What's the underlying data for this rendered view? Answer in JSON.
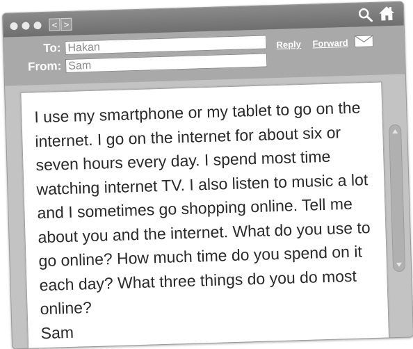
{
  "email": {
    "to_label": "To:",
    "to_value": "Hakan",
    "from_label": "From:",
    "from_value": "Sam",
    "reply_label": "Reply",
    "forward_label": "Forward",
    "body_text": "I use my smartphone or my tablet to go on the internet. I go on the internet for about six or seven hours every day. I spend most time watching internet TV. I also listen to music a lot and I sometimes go shopping online. Tell me about you and the internet. What do you use to go online? How much time do you spend on it each day? What three things do you do most online?",
    "signature": "Sam"
  },
  "titlebar": {
    "back_glyph": "<",
    "forward_glyph": ">"
  },
  "icons": {
    "search": "search-icon",
    "home": "home-icon",
    "mail": "envelope-icon"
  },
  "colors": {
    "titlebar": "#7c7c7c",
    "header": "#a9a9a9",
    "frame": "#c3c3c3",
    "text": "#2a2a2a",
    "field_text": "#8c8c8c"
  }
}
